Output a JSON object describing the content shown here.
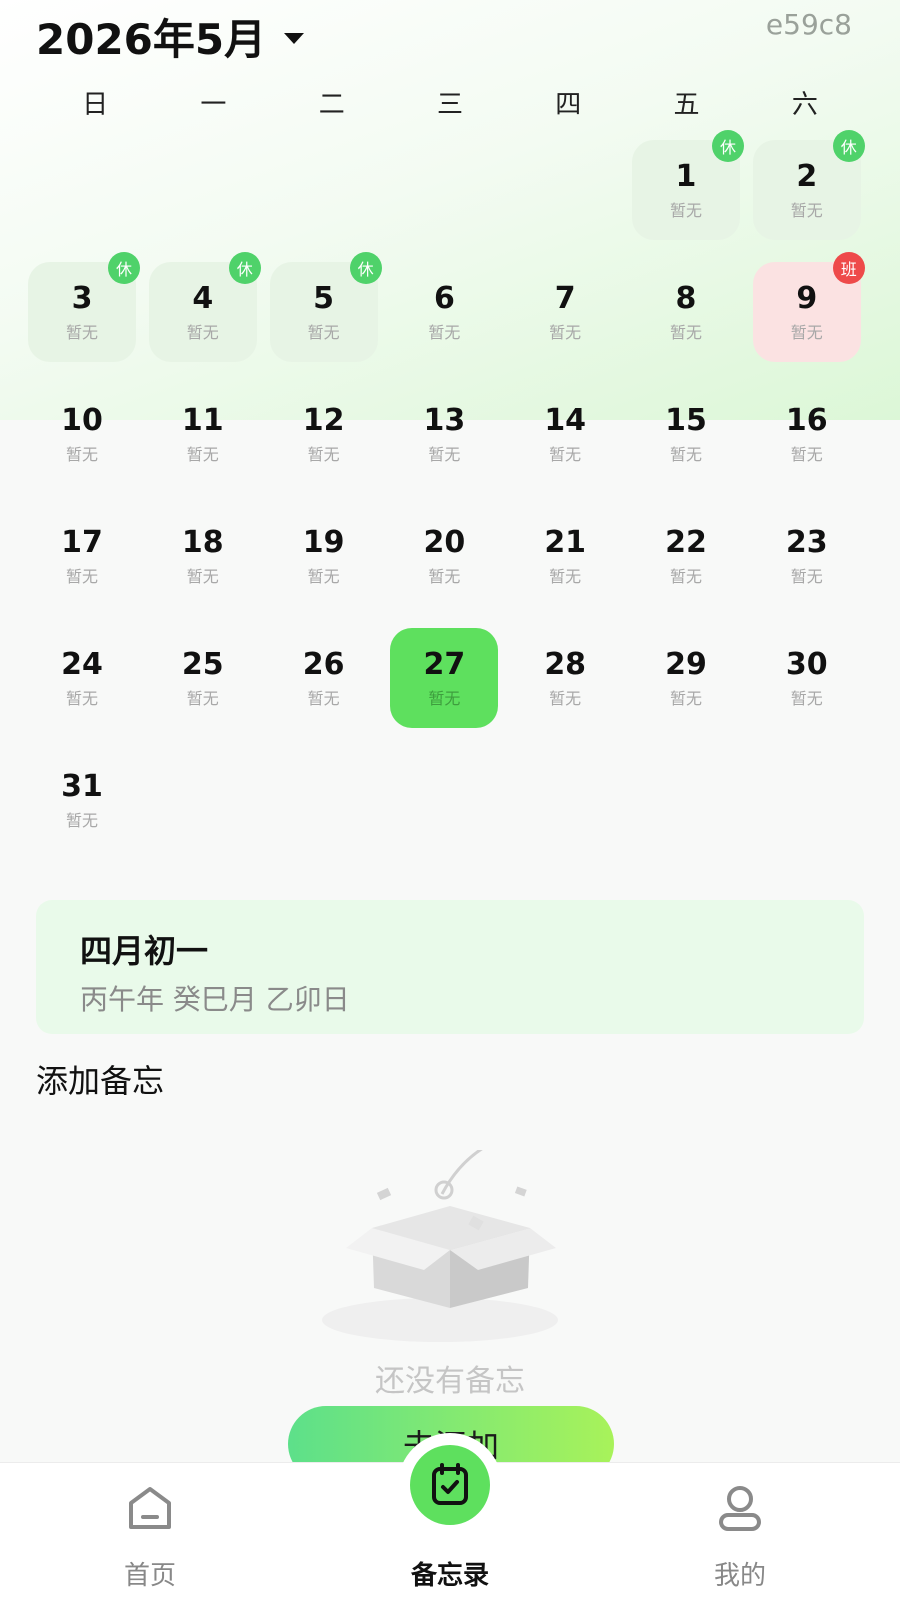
{
  "header": {
    "month_title": "2026年5月",
    "code_tag": "e59c8"
  },
  "weekdays": [
    "日",
    "一",
    "二",
    "三",
    "四",
    "五",
    "六"
  ],
  "calendar": {
    "leading_blanks": 5,
    "days": [
      {
        "day": "1",
        "sub": "暂无",
        "type": "rest",
        "badge": "休"
      },
      {
        "day": "2",
        "sub": "暂无",
        "type": "rest",
        "badge": "休"
      },
      {
        "day": "3",
        "sub": "暂无",
        "type": "rest",
        "badge": "休"
      },
      {
        "day": "4",
        "sub": "暂无",
        "type": "rest",
        "badge": "休"
      },
      {
        "day": "5",
        "sub": "暂无",
        "type": "rest",
        "badge": "休"
      },
      {
        "day": "6",
        "sub": "暂无",
        "type": "",
        "badge": ""
      },
      {
        "day": "7",
        "sub": "暂无",
        "type": "",
        "badge": ""
      },
      {
        "day": "8",
        "sub": "暂无",
        "type": "",
        "badge": ""
      },
      {
        "day": "9",
        "sub": "暂无",
        "type": "work",
        "badge": "班"
      },
      {
        "day": "10",
        "sub": "暂无",
        "type": "",
        "badge": ""
      },
      {
        "day": "11",
        "sub": "暂无",
        "type": "",
        "badge": ""
      },
      {
        "day": "12",
        "sub": "暂无",
        "type": "",
        "badge": ""
      },
      {
        "day": "13",
        "sub": "暂无",
        "type": "",
        "badge": ""
      },
      {
        "day": "14",
        "sub": "暂无",
        "type": "",
        "badge": ""
      },
      {
        "day": "15",
        "sub": "暂无",
        "type": "",
        "badge": ""
      },
      {
        "day": "16",
        "sub": "暂无",
        "type": "",
        "badge": ""
      },
      {
        "day": "17",
        "sub": "暂无",
        "type": "",
        "badge": ""
      },
      {
        "day": "18",
        "sub": "暂无",
        "type": "",
        "badge": ""
      },
      {
        "day": "19",
        "sub": "暂无",
        "type": "",
        "badge": ""
      },
      {
        "day": "20",
        "sub": "暂无",
        "type": "",
        "badge": ""
      },
      {
        "day": "21",
        "sub": "暂无",
        "type": "",
        "badge": ""
      },
      {
        "day": "22",
        "sub": "暂无",
        "type": "",
        "badge": ""
      },
      {
        "day": "23",
        "sub": "暂无",
        "type": "",
        "badge": ""
      },
      {
        "day": "24",
        "sub": "暂无",
        "type": "",
        "badge": ""
      },
      {
        "day": "25",
        "sub": "暂无",
        "type": "",
        "badge": ""
      },
      {
        "day": "26",
        "sub": "暂无",
        "type": "",
        "badge": ""
      },
      {
        "day": "27",
        "sub": "暂无",
        "type": "today",
        "badge": ""
      },
      {
        "day": "28",
        "sub": "暂无",
        "type": "",
        "badge": ""
      },
      {
        "day": "29",
        "sub": "暂无",
        "type": "",
        "badge": ""
      },
      {
        "day": "30",
        "sub": "暂无",
        "type": "",
        "badge": ""
      },
      {
        "day": "31",
        "sub": "暂无",
        "type": "",
        "badge": ""
      }
    ]
  },
  "lunar": {
    "date": "四月初一",
    "ganzhi": "丙午年 癸巳月 乙卯日"
  },
  "memo": {
    "section_title": "添加备忘",
    "empty_text": "还没有备忘",
    "add_button": "去添加"
  },
  "tabbar": {
    "items": [
      {
        "label": "首页",
        "icon": "home-icon",
        "active": false
      },
      {
        "label": "备忘录",
        "icon": "memo-icon",
        "active": true
      },
      {
        "label": "我的",
        "icon": "profile-icon",
        "active": false
      }
    ]
  },
  "colors": {
    "accent": "#5ee05e",
    "rest_bg": "#e7f4e5",
    "work_bg": "#fbe2e2",
    "rest_badge": "#4fd26a",
    "work_badge": "#ee4a4a"
  }
}
